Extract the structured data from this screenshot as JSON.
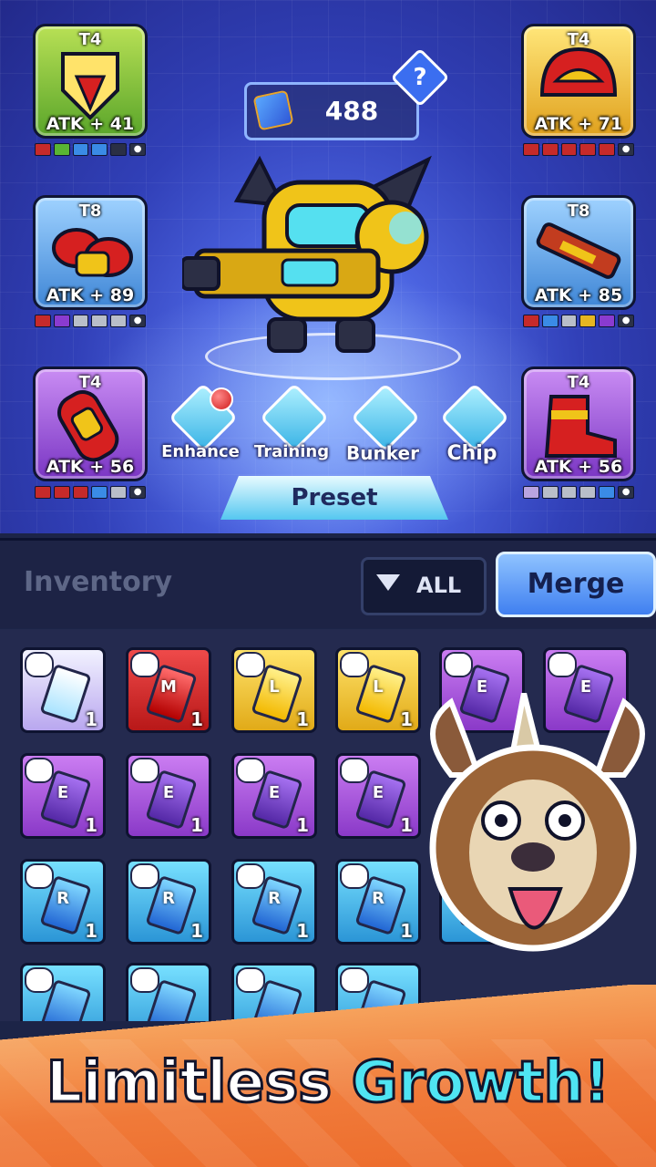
{
  "currency": {
    "value": "488",
    "icon": "blue-ticket-icon"
  },
  "help": {
    "label": "?"
  },
  "slots": [
    {
      "tier": "T4",
      "stat": "ATK + 41",
      "item": "chest-armor-icon",
      "bg": "bg-green",
      "gems": [
        "#c62a2a",
        "#59b533",
        "#3a8be6",
        "#3a8be6",
        "#2a2f45"
      ]
    },
    {
      "tier": "T8",
      "stat": "ATK + 89",
      "item": "gauntlet-icon",
      "bg": "bg-blue",
      "gems": [
        "#c62a2a",
        "#8a3bd0",
        "#b9bec9",
        "#b9bec9",
        "#b9bec9"
      ]
    },
    {
      "tier": "T4",
      "stat": "ATK + 56",
      "item": "arm-cannon-icon",
      "bg": "bg-purple",
      "gems": [
        "#c62a2a",
        "#c62a2a",
        "#c62a2a",
        "#3a8be6",
        "#b9bec9"
      ]
    },
    {
      "tier": "T4",
      "stat": "ATK + 71",
      "item": "helmet-icon",
      "bg": "bg-yellow",
      "gems": [
        "#c62a2a",
        "#c62a2a",
        "#c62a2a",
        "#c62a2a",
        "#c62a2a"
      ]
    },
    {
      "tier": "T8",
      "stat": "ATK + 85",
      "item": "blaster-icon",
      "bg": "bg-blue",
      "gems": [
        "#c62a2a",
        "#3a8be6",
        "#b9bec9",
        "#e6b622",
        "#8a3bd0"
      ]
    },
    {
      "tier": "T4",
      "stat": "ATK + 56",
      "item": "boots-icon",
      "bg": "bg-purple",
      "gems": [
        "#b9a4e0",
        "#b9bec9",
        "#b9bec9",
        "#b9bec9",
        "#3a8be6"
      ]
    }
  ],
  "actions": [
    {
      "label": "Enhance",
      "icon": "anvil-icon",
      "dot": true
    },
    {
      "label": "Training",
      "icon": "brain-icon",
      "dot": false
    },
    {
      "label": "Bunker",
      "icon": "bunker-icon",
      "dot": false
    },
    {
      "label": "Chip",
      "icon": "chip-stack-icon",
      "dot": false
    }
  ],
  "preset_label": "Preset",
  "inventory": {
    "title": "Inventory",
    "filter_label": "ALL",
    "merge_label": "Merge",
    "rows": [
      [
        {
          "grade": "white",
          "letter": "",
          "count": "1"
        },
        {
          "grade": "red",
          "letter": "M",
          "count": "1"
        },
        {
          "grade": "gold",
          "letter": "L",
          "count": "1"
        },
        {
          "grade": "gold",
          "letter": "L",
          "count": "1"
        },
        {
          "grade": "purple",
          "letter": "E",
          "count": ""
        },
        {
          "grade": "purple",
          "letter": "E",
          "count": ""
        }
      ],
      [
        {
          "grade": "purple",
          "letter": "E",
          "count": "1"
        },
        {
          "grade": "purple",
          "letter": "E",
          "count": "1"
        },
        {
          "grade": "purple",
          "letter": "E",
          "count": "1"
        },
        {
          "grade": "purple",
          "letter": "E",
          "count": "1"
        }
      ],
      [
        {
          "grade": "cyan",
          "letter": "R",
          "count": "1"
        },
        {
          "grade": "cyan",
          "letter": "R",
          "count": "1"
        },
        {
          "grade": "cyan",
          "letter": "R",
          "count": "1"
        },
        {
          "grade": "cyan",
          "letter": "R",
          "count": "1"
        },
        {
          "grade": "cyan",
          "letter": "R",
          "count": ""
        }
      ],
      [
        {
          "grade": "cyan",
          "letter": "",
          "count": ""
        },
        {
          "grade": "cyan",
          "letter": "",
          "count": ""
        },
        {
          "grade": "cyan",
          "letter": "",
          "count": ""
        },
        {
          "grade": "cyan",
          "letter": "",
          "count": ""
        }
      ]
    ]
  },
  "tagline": {
    "part1": "Limitless",
    "part2": "Growth!"
  },
  "colors": {
    "accent": "#4fe4f2",
    "banner": "#f07a39",
    "panel": "#242a4f"
  }
}
